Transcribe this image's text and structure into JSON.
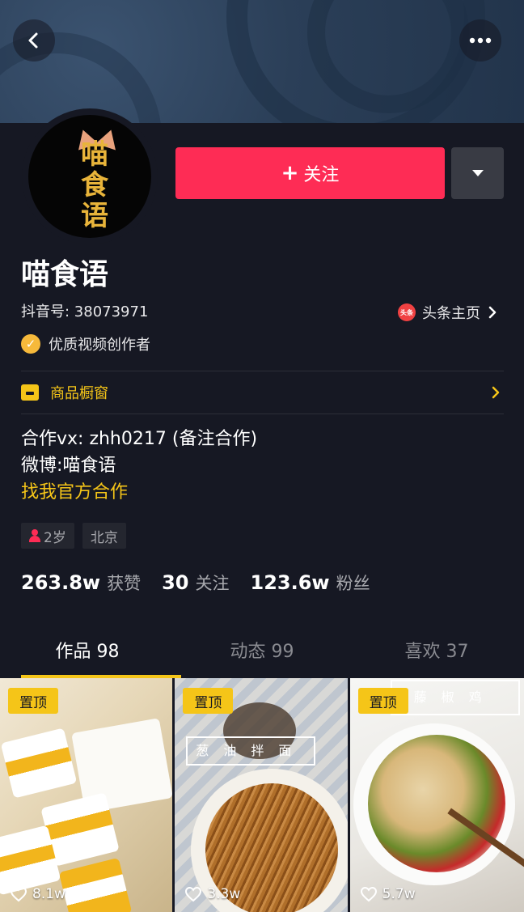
{
  "header": {
    "back_icon": "chevron-left-icon",
    "more_icon": "more-horizontal-icon"
  },
  "profile": {
    "avatar_text": "喵食语",
    "name": "喵食语",
    "douyin_id": "抖音号: 38073971",
    "toutiao_link": "头条主页",
    "toutiao_icon_text": "头条",
    "verified_label": "优质视频创作者",
    "follow_label": "关注",
    "follow_plus": "+"
  },
  "shop": {
    "label": "商品橱窗"
  },
  "bio": {
    "line1": "合作vx: zhh0217 (备注合作)",
    "line2": "微博:喵食语",
    "link": "找我官方合作"
  },
  "tags": {
    "age": "2岁",
    "city": "北京"
  },
  "stats": [
    {
      "num": "263.8w",
      "label": "获赞"
    },
    {
      "num": "30",
      "label": "关注"
    },
    {
      "num": "123.6w",
      "label": "粉丝"
    }
  ],
  "tabs": [
    {
      "label": "作品 98",
      "active": true
    },
    {
      "label": "动态 99",
      "active": false
    },
    {
      "label": "喜欢 37",
      "active": false
    }
  ],
  "videos": [
    {
      "pin": "置顶",
      "likes": "8.1w"
    },
    {
      "pin": "置顶",
      "likes": "3.3w",
      "sign": "葱油拌面"
    },
    {
      "pin": "置顶",
      "likes": "5.7w",
      "sign": "藤椒鸡"
    }
  ],
  "colors": {
    "background": "#161823",
    "accent": "#fe2c55",
    "highlight": "#f5c518"
  }
}
